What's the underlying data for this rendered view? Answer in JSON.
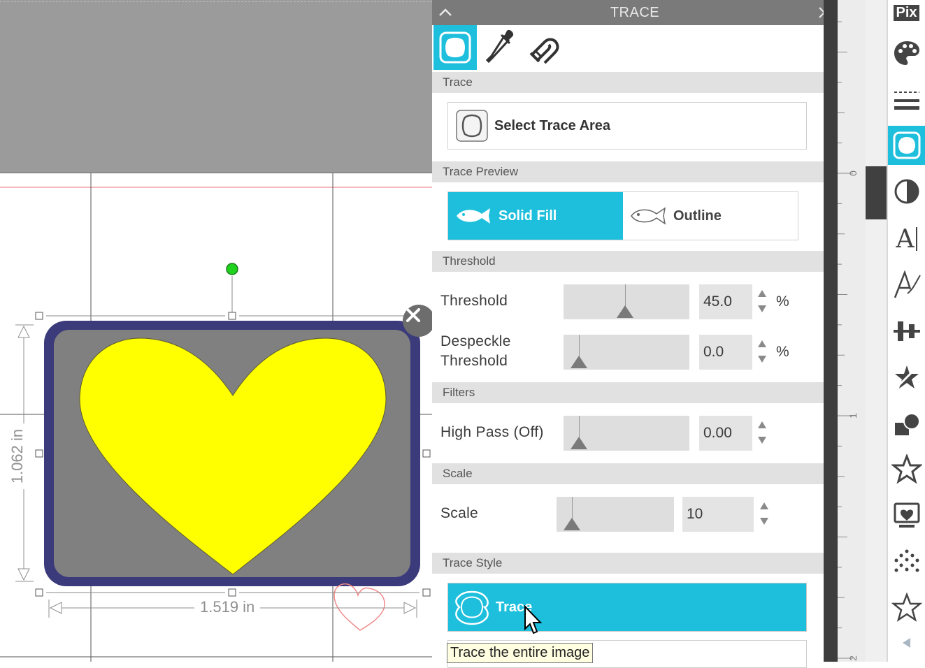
{
  "panel": {
    "title": "TRACE",
    "sections": {
      "trace": "Trace",
      "trace_preview": "Trace Preview",
      "threshold": "Threshold",
      "filters": "Filters",
      "scale": "Scale",
      "trace_style": "Trace Style"
    },
    "select_trace_area_label": "Select Trace Area",
    "preview_options": {
      "solid_fill": "Solid Fill",
      "outline": "Outline",
      "selected": "Solid Fill"
    },
    "threshold": {
      "label": "Threshold",
      "value": "45.0",
      "unit": "%",
      "level": 45
    },
    "despeckle": {
      "label_line1": "Despeckle",
      "label_line2": "Threshold",
      "value": "0.0",
      "unit": "%",
      "level": 0
    },
    "high_pass": {
      "label": "High Pass (Off)",
      "value": "0.00",
      "level": 0
    },
    "scale": {
      "label": "Scale",
      "value": "10",
      "level": 0
    },
    "trace_button_label": "Trace",
    "tooltip": "Trace the entire image"
  },
  "canvas": {
    "width_dimension": "1.519 in",
    "height_dimension": "1.062 in",
    "shape_fill": "#ffff00",
    "frame_color": "#3b3a7a",
    "backdrop_color": "#808080"
  },
  "toolbar": {
    "pix_label": "Pix",
    "text_tool_label": "A",
    "active_tool": "trace"
  },
  "ruler": {
    "labels": [
      "0",
      "1",
      "2"
    ]
  },
  "colors": {
    "accent": "#1ebfdc",
    "panel_title_bg": "#7a7a7a",
    "section_bg": "#e1e1e1"
  }
}
